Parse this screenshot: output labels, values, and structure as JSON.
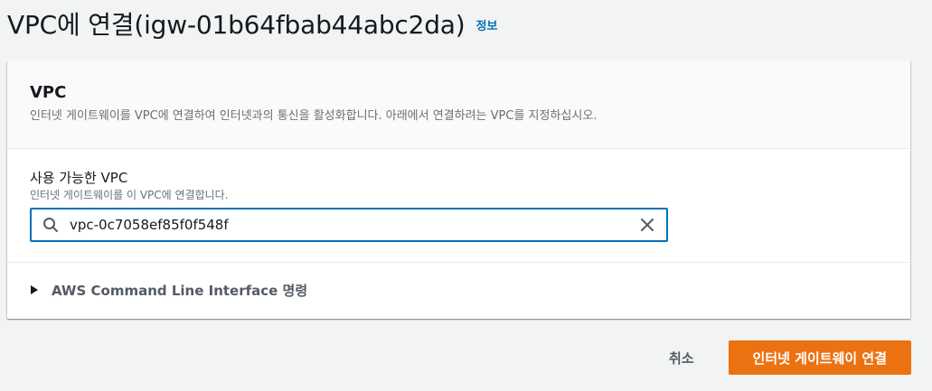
{
  "header": {
    "title": "VPC에 연결(igw-01b64fbab44abc2da)",
    "info_link": "정보"
  },
  "card": {
    "title": "VPC",
    "description": "인터넷 게이트웨이를 VPC에 연결하여 인터넷과의 통신을 활성화합니다. 아래에서 연결하려는 VPC를 지정하십시오."
  },
  "field": {
    "label": "사용 가능한 VPC",
    "hint": "인터넷 게이트웨이를 이 VPC에 연결합니다.",
    "value": "vpc-0c7058ef85f0f548f"
  },
  "cli_expander": {
    "label": "AWS Command Line Interface 명령"
  },
  "actions": {
    "cancel_label": "취소",
    "submit_label": "인터넷 게이트웨이 연결"
  },
  "colors": {
    "primary": "#ec7211",
    "link": "#0073bb",
    "focus_border": "#0073bb"
  },
  "icons": [
    "search-icon",
    "clear-icon",
    "caret-right-icon"
  ]
}
